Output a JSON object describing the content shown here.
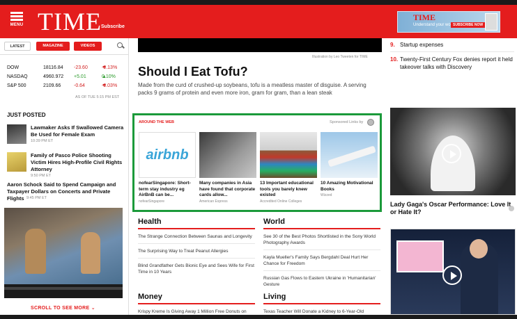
{
  "header": {
    "menu_label": "MENU",
    "logo": "TIME",
    "subscribe": "Subscribe",
    "ad": {
      "logo": "TIME",
      "text": "Understand your world",
      "button": "SUBSCRIBE NOW"
    }
  },
  "sidebar": {
    "tabs": {
      "latest": "LATEST",
      "magazine": "MAGAZINE",
      "videos": "VIDEOS"
    },
    "markets": [
      {
        "name": "DOW",
        "value": "18116.84",
        "change": "-23.60",
        "pct": "-0.13%",
        "dir": "down"
      },
      {
        "name": "NASDAQ",
        "value": "4960.972",
        "change": "+5.01",
        "pct": "0.10%",
        "dir": "up"
      },
      {
        "name": "S&P 500",
        "value": "2109.66",
        "change": "-0.64",
        "pct": "-0.03%",
        "dir": "down"
      }
    ],
    "as_of": "AS OF TUE 5:15 PM EST",
    "just_posted": "JUST POSTED",
    "posts": [
      {
        "title": "Lawmaker Asks If Swallowed Camera Be Used for Female Exam",
        "time": "10:39 PM ET"
      },
      {
        "title": "Family of Pasco Police Shooting Victim Hires High-Profile Civil Rights Attorney",
        "time": "9:50 PM ET"
      },
      {
        "title": "Aaron Schock Said to Spend Campaign and Taxpayer Dollars on Concerts and Private Flights",
        "time": "9:45 PM ET"
      }
    ],
    "scroll_more": "SCROLL TO SEE MORE"
  },
  "main": {
    "credit": "Illustration by Leo Tweeten for TIME",
    "headline": "Should I Eat Tofu?",
    "dek": "Made from the curd of crushed-up soybeans, tofu is a meatless master of disguise. A serving packs 9 grams of protein and even more iron, gram for gram, than a lean steak",
    "around": {
      "label": "AROUND THE WEB",
      "sponsored": "Sponsored Links by",
      "tiles": [
        {
          "title": "nofearSingapore: Short-term stay industry eg AirBnB can be...",
          "source": "nofearSingapore",
          "logo": "airbnb"
        },
        {
          "title": "Many companies in Asia have found that corporate cards allow...",
          "source": "American Express"
        },
        {
          "title": "13 Important educational tools you barely knew existed",
          "source": "Accredited Online Colleges"
        },
        {
          "title": "10 Amazing Motivational Books",
          "source": "Wizzed"
        }
      ]
    },
    "sections": {
      "health": {
        "title": "Health",
        "items": [
          "The Strange Connection Between Saunas and Longevity",
          "The Surprising Way to Treat Peanut Allergies",
          "Blind Grandfather Gets Bionic Eye and Sees Wife for First Time in 10 Years"
        ]
      },
      "world": {
        "title": "World",
        "items": [
          "See 30 of the Best Photos Shortlisted in the Sony World Photography Awards",
          "Kayla Mueller's Family Says Bergdahl Deal Hurt Her Chance for Freedom",
          "Russian Gas Flows to Eastern Ukraine in 'Humanitarian' Gesture"
        ]
      },
      "money": {
        "title": "Money",
        "items": [
          "Krispy Kreme Is Giving Away 1 Million Free Donuts on"
        ]
      },
      "living": {
        "title": "Living",
        "items": [
          "Texas Teacher Will Donate a Kidney to 6-Year-Old"
        ]
      }
    }
  },
  "right": {
    "list": [
      {
        "num": "9.",
        "title": "Startup expenses"
      },
      {
        "num": "10.",
        "title": "Twenty-First Century Fox denies report it held takeover talks with Discovery"
      }
    ],
    "video1_caption": "Lady Gaga's Oscar Performance: Love It or Hate It?"
  }
}
